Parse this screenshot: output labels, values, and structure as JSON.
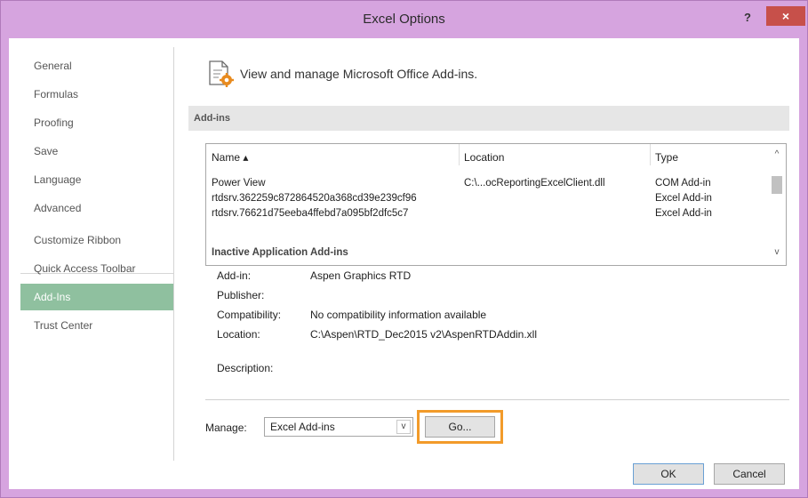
{
  "window": {
    "title": "Excel Options",
    "help_label": "?",
    "close_label": "×"
  },
  "sidebar": {
    "items": [
      {
        "label": "General"
      },
      {
        "label": "Formulas"
      },
      {
        "label": "Proofing"
      },
      {
        "label": "Save"
      },
      {
        "label": "Language"
      },
      {
        "label": "Advanced"
      },
      {
        "label": "Customize Ribbon"
      },
      {
        "label": "Quick Access Toolbar"
      },
      {
        "label": "Add-Ins"
      },
      {
        "label": "Trust Center"
      }
    ],
    "selected": "Add-Ins"
  },
  "main": {
    "header": "View and manage Microsoft Office Add-ins.",
    "section_title": "Add-ins",
    "table": {
      "columns": [
        "Name ▴",
        "Location",
        "Type"
      ],
      "rows": [
        {
          "name": "Power View",
          "location": "C:\\...ocReportingExcelClient.dll",
          "type": "COM Add-in"
        },
        {
          "name": "rtdsrv.362259c872864520a368cd39e239cf96",
          "location": "",
          "type": "Excel Add-in"
        },
        {
          "name": "rtdsrv.76621d75eeba4ffebd7a095bf2dfc5c7",
          "location": "",
          "type": "Excel Add-in"
        }
      ],
      "group_header": "Inactive Application Add-ins",
      "scroll_up": "^",
      "scroll_down": "v"
    },
    "details": {
      "addin_label": "Add-in:",
      "addin_value": "Aspen Graphics RTD",
      "publisher_label": "Publisher:",
      "publisher_value": "",
      "compatibility_label": "Compatibility:",
      "compatibility_value": "No compatibility information available",
      "location_label": "Location:",
      "location_value": "C:\\Aspen\\RTD_Dec2015 v2\\AspenRTDAddin.xll",
      "description_label": "Description:",
      "description_value": ""
    },
    "manage": {
      "label": "Manage:",
      "selected": "Excel Add-ins",
      "arrow": "v",
      "go_label": "Go..."
    }
  },
  "footer": {
    "ok_label": "OK",
    "cancel_label": "Cancel"
  },
  "colors": {
    "titlebar": "#d6a4df",
    "close_button": "#c7504a",
    "selected_nav": "#8fc09f",
    "go_highlight": "#f29b2a"
  }
}
